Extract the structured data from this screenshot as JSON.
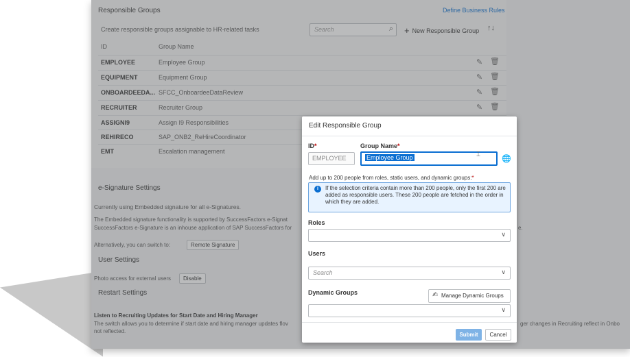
{
  "groups_panel": {
    "title": "Responsible Groups",
    "define_link": "Define Business Rules",
    "subtitle": "Create responsible groups assignable to HR-related tasks",
    "search_placeholder": "Search",
    "new_button": "New Responsible Group",
    "columns": [
      "ID",
      "Group Name"
    ],
    "rows": [
      {
        "id": "EMPLOYEE",
        "name": "Employee Group"
      },
      {
        "id": "EQUIPMENT",
        "name": "Equipment Group"
      },
      {
        "id": "ONBOARDEEDA...",
        "name": "SFCC_OnboardeeDataReview"
      },
      {
        "id": "RECRUITER",
        "name": "Recruiter Group"
      },
      {
        "id": "ASSIGNI9",
        "name": "Assign I9 Responsibilities"
      },
      {
        "id": "REHIRECO",
        "name": "SAP_ONB2_ReHireCoordinator"
      },
      {
        "id": "EMT",
        "name": "Escalation management"
      }
    ]
  },
  "esig": {
    "title": "e-Signature Settings",
    "current": "Currently using Embedded signature for all e-Signatures.",
    "line1": "The Embedded signature functionality is supported by SuccessFactors e-Signat",
    "line2": "SuccessFactors e-Signature is an inhouse application of SAP SuccessFactors for",
    "line2_right": "e.",
    "switch_text": "Alternatively, you can switch to:",
    "switch_button": "Remote Signature"
  },
  "user_settings": {
    "title": "User Settings",
    "photo_text": "Photo access for external users",
    "disable_button": "Disable"
  },
  "restart": {
    "title": "Restart Settings",
    "heading": "Listen to Recruiting Updates for Start Date and Hiring Manager",
    "line1": "The switch allows you to determine if start date and hiring manager updates flov",
    "line1_right": "ger changes in Recruiting reflect in Onbo",
    "line2": "not reflected."
  },
  "dialog": {
    "title": "Edit Responsible Group",
    "id_label": "ID",
    "id_value": "EMPLOYEE",
    "name_label": "Group Name",
    "name_value": "Employee Group",
    "hint": "Add up to 200 people from roles, static users, and dynamic groups:",
    "info_text": "If the selection criteria contain more than 200 people, only the first 200 are added as responsible users. These 200 people are fetched in the order in which they are added.",
    "roles_label": "Roles",
    "users_label": "Users",
    "users_placeholder": "Search",
    "dynamic_label": "Dynamic Groups",
    "manage_button": "Manage Dynamic Groups",
    "submit": "Submit",
    "cancel": "Cancel"
  },
  "colors": {
    "accent": "#0a6ed1",
    "required": "#bb0000",
    "overlay": "#5a5c60"
  }
}
